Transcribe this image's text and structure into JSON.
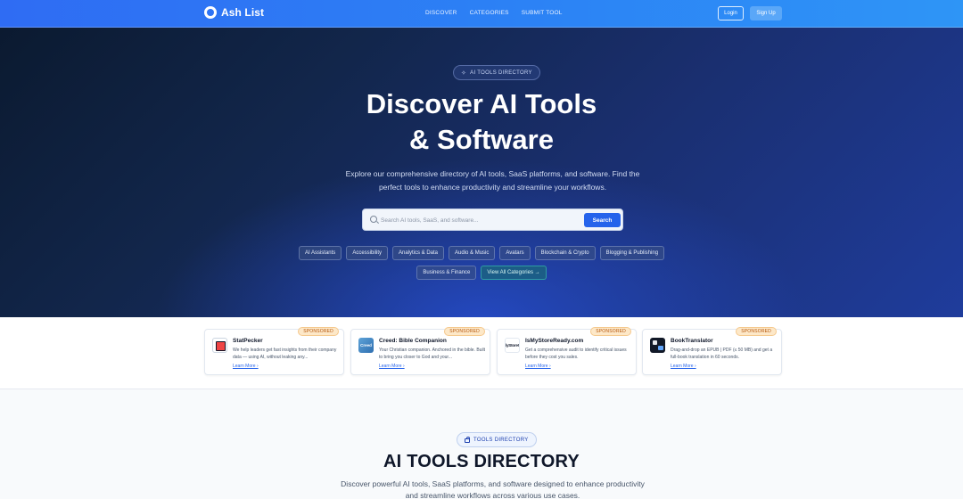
{
  "header": {
    "brand": "Ash List",
    "nav": [
      "DISCOVER",
      "CATEGORIES",
      "SUBMIT TOOL"
    ],
    "login_label": "Login",
    "signup_label": "Sign Up"
  },
  "hero": {
    "badge": "AI TOOLS DIRECTORY",
    "title_line1": "Discover AI Tools",
    "title_line2": "& Software",
    "subtitle": "Explore our comprehensive directory of AI tools, SaaS platforms, and software. Find the perfect tools to enhance productivity and streamline your workflows.",
    "search": {
      "placeholder": "Search AI tools, SaaS, and software...",
      "button_label": "Search"
    },
    "categories_row1": [
      "AI Assistants",
      "Accessibility",
      "Analytics & Data",
      "Audio & Music",
      "Avatars",
      "Blockchain & Crypto",
      "Blogging & Publishing"
    ],
    "categories_row2": [
      "Business & Finance"
    ],
    "view_all_label": "View All Categories →"
  },
  "sponsored": [
    {
      "badge": "SPONSORED",
      "name": "StatPecker",
      "desc": "We help leaders get fast insights from their company data — using AI, without leaking any...",
      "link": "Learn More ›",
      "logo": "statpecker-logo"
    },
    {
      "badge": "SPONSORED",
      "name": "Creed: Bible Companion",
      "desc": "Your Christian companion. Anchored in the bible. Built to bring you closer to God and your...",
      "link": "Learn More ›",
      "logo_text": "Creed"
    },
    {
      "badge": "SPONSORED",
      "name": "IsMyStoreReady.com",
      "desc": "Get a comprehensive audit to identify critical issues before they cost you sales.",
      "link": "Learn More ›",
      "logo_text": "lyStore!"
    },
    {
      "badge": "SPONSORED",
      "name": "BookTranslator",
      "desc": "Drag-and-drop an EPUB | PDF (≤ 50 MB) and get a full-book translation in 60 seconds.",
      "link": "Learn More ›",
      "logo": "booktranslator-logo"
    }
  ],
  "directory": {
    "badge": "TOOLS DIRECTORY",
    "title": "AI TOOLS DIRECTORY",
    "subtitle": "Discover powerful AI tools, SaaS platforms, and software designed to enhance productivity and streamline workflows across various use cases."
  },
  "colors": {
    "primary": "#2563eb",
    "header_gradient_start": "#2f6cf3",
    "hero_dark": "#0b1a30",
    "sponsored_badge": "#fde8c8"
  }
}
